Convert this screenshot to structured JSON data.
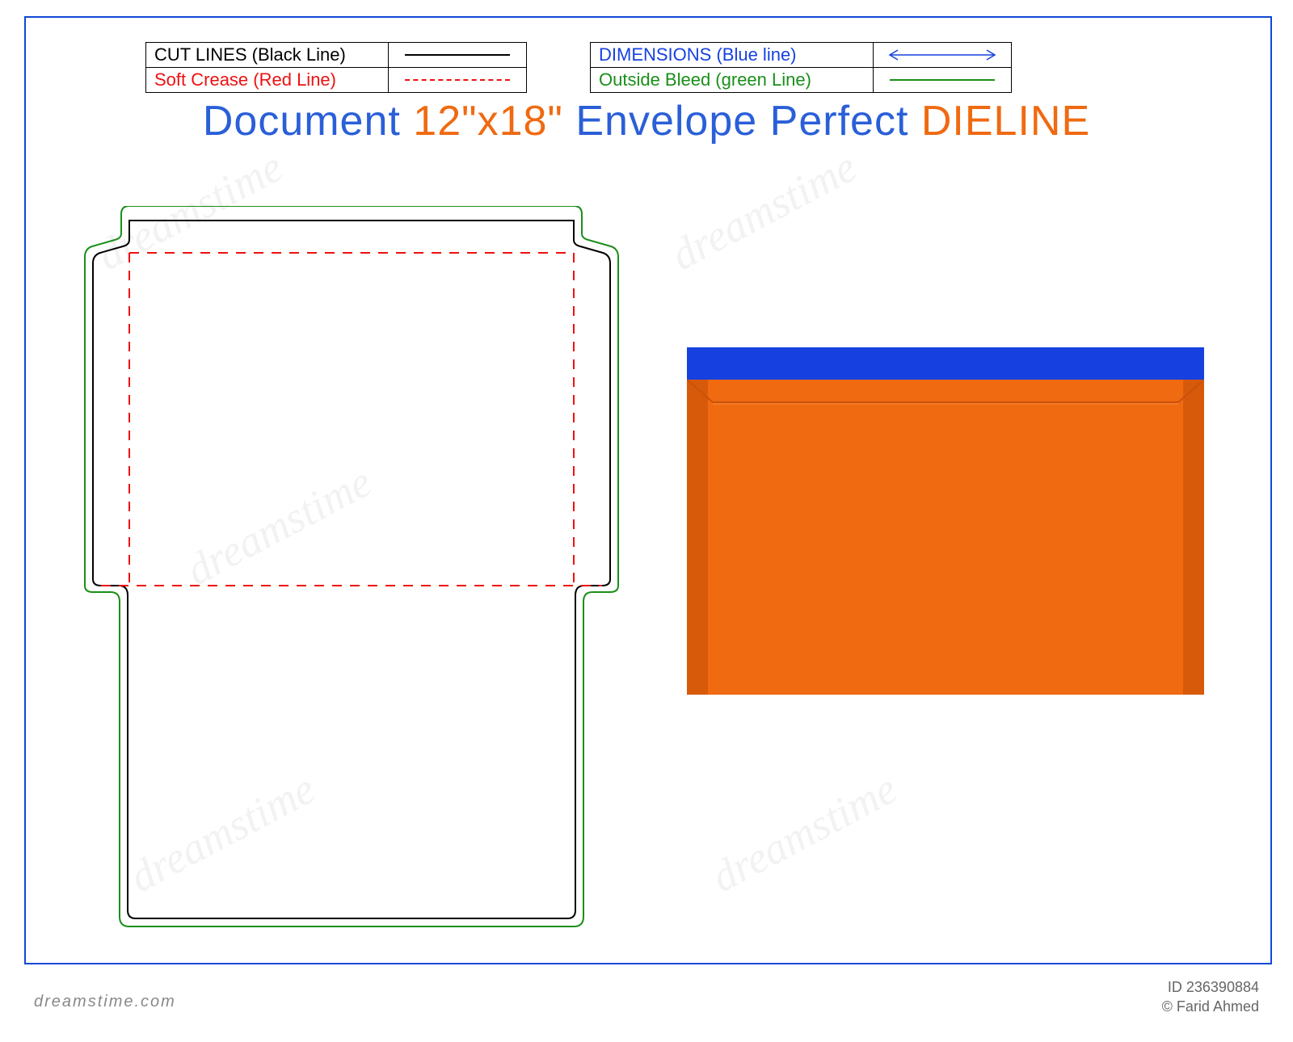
{
  "legend": {
    "cut": "CUT LINES (Black Line)",
    "crease": "Soft Crease (Red Line)",
    "dims": "DIMENSIONS (Blue line)",
    "bleed": "Outside Bleed (green Line)"
  },
  "title": {
    "w1": "Document",
    "w2": "12\"x18\"",
    "w3": "Envelope",
    "w4": "Perfect",
    "w5": "DIELINE"
  },
  "colors": {
    "blue": "#2a5fd8",
    "orange": "#ef6a11",
    "red": "#e11",
    "green": "#1a8f1a",
    "black": "#000000",
    "envFlap": "#1641e0",
    "envBody": "#ef6a11",
    "envSide": "#d75a0b"
  },
  "footer": {
    "site": "dreamstime.com",
    "id": "ID 236390884",
    "author": "© Farid Ahmed"
  },
  "watermark": "dreamstime"
}
